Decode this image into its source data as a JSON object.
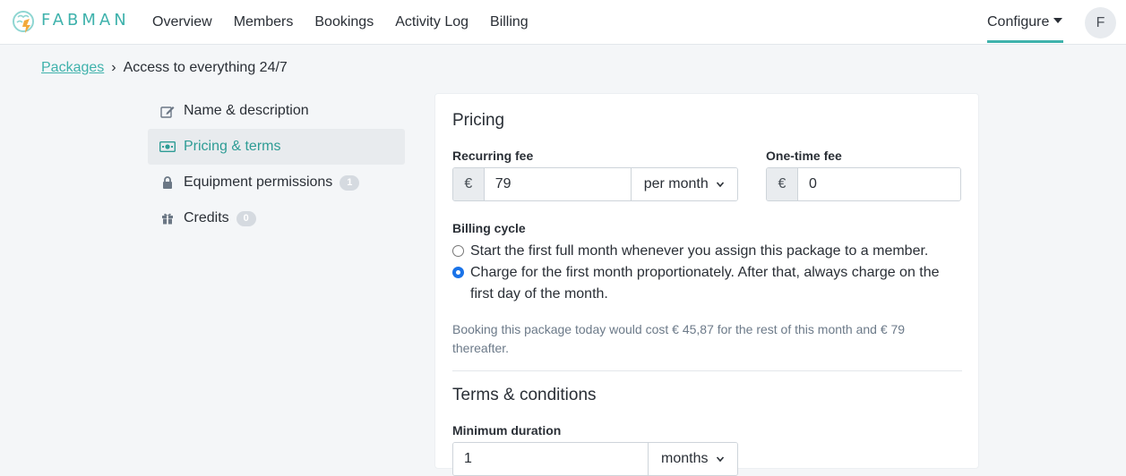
{
  "brand": {
    "name": "FABMAN",
    "accent": "#3fb2ac"
  },
  "nav": {
    "items": [
      "Overview",
      "Members",
      "Bookings",
      "Activity Log",
      "Billing"
    ],
    "configure": "Configure",
    "avatar_initial": "F"
  },
  "breadcrumb": {
    "parent": "Packages",
    "separator": "›",
    "current": "Access to everything 24/7"
  },
  "sidebar": {
    "items": [
      {
        "label": "Name & description",
        "icon": "edit-icon"
      },
      {
        "label": "Pricing & terms",
        "icon": "money-icon",
        "active": true
      },
      {
        "label": "Equipment permissions",
        "icon": "lock-icon",
        "count": "1"
      },
      {
        "label": "Credits",
        "icon": "gift-icon",
        "count": "0"
      }
    ]
  },
  "pricing": {
    "title": "Pricing",
    "recurring_fee": {
      "label": "Recurring fee",
      "currency": "€",
      "value": "79",
      "period": "per month"
    },
    "one_time_fee": {
      "label": "One-time fee",
      "currency": "€",
      "value": "0"
    },
    "billing_cycle": {
      "label": "Billing cycle",
      "option1": "Start the first full month whenever you assign this package to a member.",
      "option2_line1": "Charge for the first month proportionately. After that, always charge on the",
      "option2_line2": "first day of the month."
    },
    "hint_line1": "Booking this package today would cost € 45,87 for the rest of this month and € 79",
    "hint_line2": "thereafter."
  },
  "terms": {
    "title": "Terms & conditions",
    "minimum_duration": {
      "label": "Minimum duration",
      "value": "1",
      "unit": "months"
    }
  }
}
